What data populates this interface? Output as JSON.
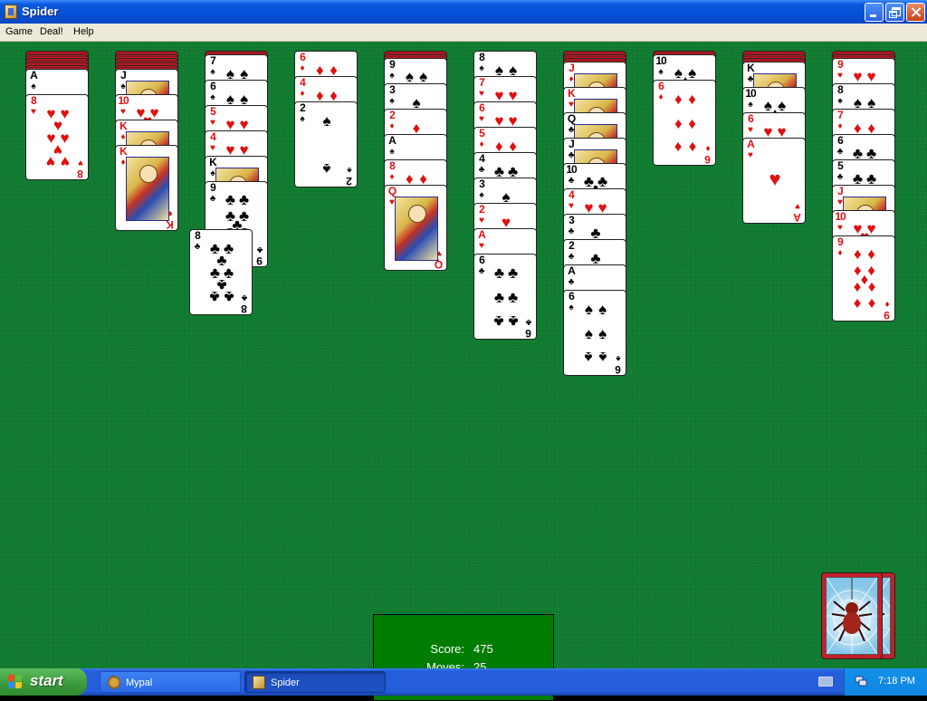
{
  "window": {
    "title": "Spider"
  },
  "menu": {
    "items": [
      "Game",
      "Deal!",
      "Help"
    ]
  },
  "status": {
    "score_label": "Score:",
    "score": "475",
    "moves_label": "Moves:",
    "moves": "25"
  },
  "taskbar": {
    "start_label": "start",
    "tasks": [
      {
        "label": "Mypal"
      },
      {
        "label": "Spider"
      }
    ],
    "clock": "7:18 PM"
  },
  "colors": {
    "felt": "#0e7a2e",
    "score_box": "#007c00",
    "card_red": "#e01010",
    "card_black": "#000000"
  },
  "tableau": [
    {
      "hidden": 5,
      "cards": [
        {
          "rank": "A",
          "suit": "♠"
        },
        {
          "rank": "8",
          "suit": "♥"
        }
      ]
    },
    {
      "hidden": 5,
      "cards": [
        {
          "rank": "J",
          "suit": "♠"
        },
        {
          "rank": "10",
          "suit": "♥"
        },
        {
          "rank": "K",
          "suit": "♦"
        },
        {
          "rank": "K",
          "suit": "♦"
        }
      ]
    },
    {
      "hidden": 1,
      "cards": [
        {
          "rank": "7",
          "suit": "♠"
        },
        {
          "rank": "6",
          "suit": "♠"
        },
        {
          "rank": "5",
          "suit": "♥"
        },
        {
          "rank": "4",
          "suit": "♥"
        },
        {
          "rank": "K",
          "suit": "♠"
        },
        {
          "rank": "9",
          "suit": "♣"
        }
      ]
    },
    {
      "hidden": 0,
      "cards": [
        {
          "rank": "6",
          "suit": "♦"
        },
        {
          "rank": "4",
          "suit": "♦"
        },
        {
          "rank": "2",
          "suit": "♠"
        }
      ]
    },
    {
      "hidden": 2,
      "cards": [
        {
          "rank": "9",
          "suit": "♠"
        },
        {
          "rank": "3",
          "suit": "♠"
        },
        {
          "rank": "2",
          "suit": "♦"
        },
        {
          "rank": "A",
          "suit": "♠"
        },
        {
          "rank": "8",
          "suit": "♦"
        },
        {
          "rank": "Q",
          "suit": "♥"
        }
      ]
    },
    {
      "hidden": 0,
      "cards": [
        {
          "rank": "8",
          "suit": "♠"
        },
        {
          "rank": "7",
          "suit": "♥"
        },
        {
          "rank": "6",
          "suit": "♥"
        },
        {
          "rank": "5",
          "suit": "♦"
        },
        {
          "rank": "4",
          "suit": "♣"
        },
        {
          "rank": "3",
          "suit": "♠"
        },
        {
          "rank": "2",
          "suit": "♥"
        },
        {
          "rank": "A",
          "suit": "♥"
        },
        {
          "rank": "6",
          "suit": "♣"
        }
      ]
    },
    {
      "hidden": 3,
      "cards": [
        {
          "rank": "J",
          "suit": "♦"
        },
        {
          "rank": "K",
          "suit": "♥"
        },
        {
          "rank": "Q",
          "suit": "♣"
        },
        {
          "rank": "J",
          "suit": "♣"
        },
        {
          "rank": "10",
          "suit": "♣"
        },
        {
          "rank": "4",
          "suit": "♥"
        },
        {
          "rank": "3",
          "suit": "♣"
        },
        {
          "rank": "2",
          "suit": "♣"
        },
        {
          "rank": "A",
          "suit": "♣"
        },
        {
          "rank": "6",
          "suit": "♠"
        }
      ]
    },
    {
      "hidden": 1,
      "cards": [
        {
          "rank": "10",
          "suit": "♠"
        },
        {
          "rank": "6",
          "suit": "♦"
        }
      ]
    },
    {
      "hidden": 3,
      "cards": [
        {
          "rank": "K",
          "suit": "♣"
        },
        {
          "rank": "10",
          "suit": "♠"
        },
        {
          "rank": "6",
          "suit": "♥"
        },
        {
          "rank": "A",
          "suit": "♥"
        }
      ]
    },
    {
      "hidden": 2,
      "cards": [
        {
          "rank": "9",
          "suit": "♥"
        },
        {
          "rank": "8",
          "suit": "♠"
        },
        {
          "rank": "7",
          "suit": "♦"
        },
        {
          "rank": "6",
          "suit": "♣"
        },
        {
          "rank": "5",
          "suit": "♣"
        },
        {
          "rank": "J",
          "suit": "♥"
        },
        {
          "rank": "10",
          "suit": "♥"
        },
        {
          "rank": "9",
          "suit": "♦"
        }
      ]
    }
  ],
  "dragged_card": {
    "rank": "8",
    "suit": "♣"
  },
  "stock_piles": 2
}
